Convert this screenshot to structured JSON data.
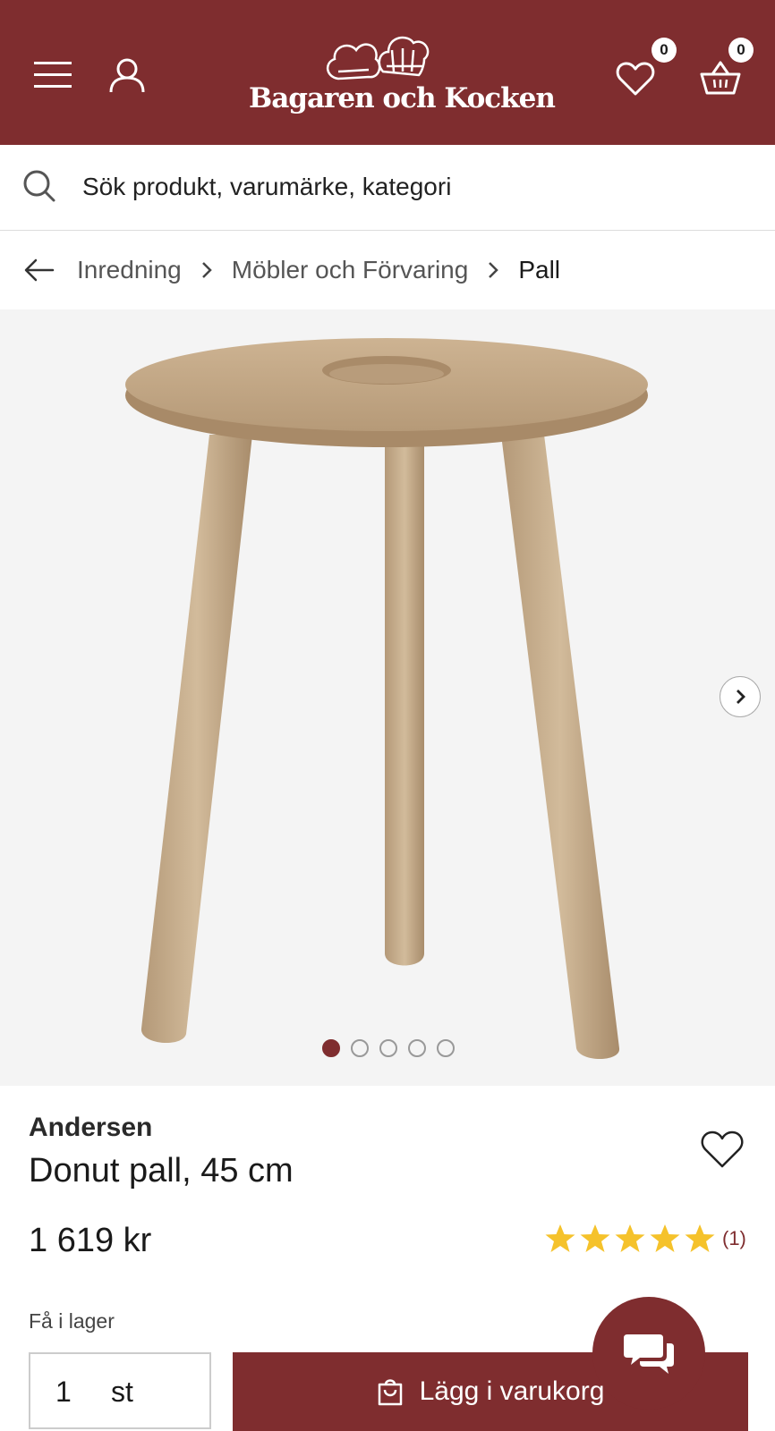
{
  "header": {
    "logo_text": "Bagaren och Kocken",
    "wishlist_count": "0",
    "cart_count": "0",
    "menu_icon": "hamburger-icon",
    "account_icon": "user-icon",
    "wishlist_icon": "heart-icon",
    "cart_icon": "basket-icon",
    "brand_color": "#7f2d2f"
  },
  "search": {
    "placeholder": "Sök produkt, varumärke, kategori",
    "icon": "search-icon"
  },
  "breadcrumb": {
    "back_icon": "arrow-left-icon",
    "items": [
      "Inredning",
      "Möbler och Förvaring",
      "Pall"
    ]
  },
  "gallery": {
    "image_count": 5,
    "active_index": 0,
    "next_icon": "chevron-right-icon"
  },
  "product": {
    "brand": "Andersen",
    "name": "Donut pall, 45 cm",
    "price": "1 619 kr",
    "rating": 5,
    "rating_count": "(1)",
    "stock_status": "Få i lager",
    "star_color": "#f5c22b"
  },
  "purchase": {
    "quantity": "1",
    "unit": "st",
    "add_to_cart_label": "Lägg i varukorg"
  },
  "chat": {
    "icon": "chat-bubbles-icon"
  }
}
